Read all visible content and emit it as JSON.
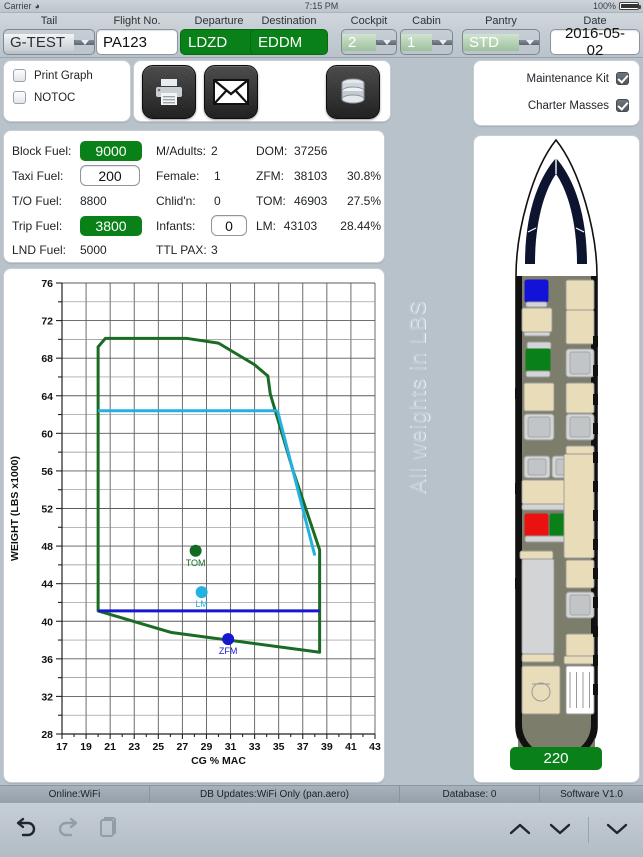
{
  "status_bar": {
    "carrier": "Carrier",
    "wifi_icon": "wifi-icon",
    "time": "7:15 PM",
    "battery_pct": "100%",
    "battery_icon": "battery-icon"
  },
  "form_bar": {
    "fields": [
      {
        "label": "Tail",
        "value": "G-TEST",
        "type": "dropdown-gray"
      },
      {
        "label": "Flight No.",
        "value": "PA123",
        "type": "text"
      },
      {
        "label": "Departure",
        "value": "LDZD",
        "type": "green"
      },
      {
        "label": "Destination",
        "value": "EDDM",
        "type": "green"
      },
      {
        "label": "Cockpit",
        "value": "2",
        "type": "dropdown-green"
      },
      {
        "label": "Cabin",
        "value": "1",
        "type": "dropdown-green"
      },
      {
        "label": "Pantry",
        "value": "STD",
        "type": "dropdown-green"
      },
      {
        "label": "Date",
        "value": "2016-05-02",
        "type": "text"
      }
    ]
  },
  "options_panel": {
    "print_graph": {
      "label": "Print Graph",
      "checked": false
    },
    "notoc": {
      "label": "NOTOC",
      "checked": false
    }
  },
  "action_buttons": [
    {
      "name": "print-button",
      "icon": "printer-icon"
    },
    {
      "name": "email-button",
      "icon": "envelope-icon"
    },
    {
      "name": "database-button",
      "icon": "database-icon"
    }
  ],
  "right_options": {
    "maintenance_kit": {
      "label": "Maintenance Kit",
      "checked": true
    },
    "charter_masses": {
      "label": "Charter Masses",
      "checked": true
    }
  },
  "weights_panel": {
    "fuel": [
      {
        "label": "Block Fuel:",
        "value": "9000",
        "style": "green"
      },
      {
        "label": "Taxi Fuel:",
        "value": "200",
        "style": "input"
      },
      {
        "label": "T/O Fuel:",
        "value": "8800",
        "style": "plain"
      },
      {
        "label": "Trip Fuel:",
        "value": "3800",
        "style": "green"
      },
      {
        "label": "LND Fuel:",
        "value": "5000",
        "style": "plain"
      }
    ],
    "pax": [
      {
        "label": "M/Adults:",
        "value": "2",
        "style": "plain"
      },
      {
        "label": "Female:",
        "value": "1",
        "style": "plain"
      },
      {
        "label": "Chlid'n:",
        "value": "0",
        "style": "plain"
      },
      {
        "label": "Infants:",
        "value": "0",
        "style": "input"
      },
      {
        "label": "TTL PAX:",
        "value": "3",
        "style": "plain"
      }
    ],
    "masses": [
      {
        "label": "DOM:",
        "value": "37256",
        "pct": ""
      },
      {
        "label": "ZFM:",
        "value": "38103",
        "pct": "30.8%"
      },
      {
        "label": "TOM:",
        "value": "46903",
        "pct": "27.5%"
      },
      {
        "label": "LM:",
        "value": "43103",
        "pct": "28.44%"
      }
    ]
  },
  "watermark": "All weights in LBS",
  "aircraft_panel": {
    "cabin_weight_value": "220",
    "seat_markers": [
      {
        "name": "seat-marker-blue",
        "color": "#1313d8"
      },
      {
        "name": "seat-marker-green",
        "color": "#0a8018"
      },
      {
        "name": "seat-marker-red",
        "color": "#ec1111"
      },
      {
        "name": "seat-marker-green2",
        "color": "#0a8018"
      }
    ]
  },
  "bottom_status": [
    {
      "name": "online-status",
      "text": "Online:WiFi"
    },
    {
      "name": "db-updates",
      "text": "DB Updates:WiFi Only   (pan.aero)"
    },
    {
      "name": "database-count",
      "text": "Database: 0"
    },
    {
      "name": "software-version",
      "text": "Software V1.0"
    }
  ],
  "bottom_bar": {
    "undo_icon": "undo-icon",
    "redo_icon": "redo-icon",
    "copy_icon": "copy-icon",
    "up_icon": "chevron-up-icon",
    "down_icon": "chevron-down-icon",
    "dismiss_icon": "chevron-down-dismiss-icon"
  },
  "chart_data": {
    "type": "scatter",
    "title": "",
    "xlabel": "CG % MAC",
    "ylabel": "WEIGHT (LBS x1000)",
    "xlim": [
      17,
      43
    ],
    "ylim": [
      28,
      76
    ],
    "xticks": [
      17,
      19,
      21,
      23,
      25,
      27,
      29,
      31,
      33,
      35,
      37,
      39,
      41,
      43
    ],
    "yticks": [
      28,
      32,
      36,
      40,
      44,
      48,
      52,
      56,
      60,
      64,
      68,
      72,
      76
    ],
    "x_minor_step": 1,
    "y_minor_step": 2,
    "grid": true,
    "legend": "none",
    "series": [
      {
        "name": "envelope",
        "type": "polygon",
        "color": "#1a6b24",
        "points": [
          [
            20.0,
            69.2
          ],
          [
            20.6,
            70.1
          ],
          [
            27.4,
            70.1
          ],
          [
            30.0,
            69.6
          ],
          [
            33.0,
            67.3
          ],
          [
            34.1,
            66.1
          ],
          [
            34.3,
            64.2
          ],
          [
            36.2,
            56.0
          ],
          [
            38.4,
            47.6
          ],
          [
            38.4,
            36.7
          ],
          [
            26.1,
            38.8
          ],
          [
            20.0,
            41.1
          ],
          [
            20.0,
            69.2
          ]
        ]
      },
      {
        "name": "lm-limit-line",
        "type": "hline",
        "color": "#22b1e0",
        "y": 62.4,
        "x_from": 20.0,
        "x_to": 34.9
      },
      {
        "name": "zfm-limit-line",
        "type": "hline",
        "color": "#1717cf",
        "y": 41.1,
        "x_from": 20.0,
        "x_to": 38.4
      },
      {
        "name": "lm-envelope-edge",
        "type": "line",
        "color": "#22b1e0",
        "points": [
          [
            34.9,
            62.4
          ],
          [
            38.0,
            47.0
          ]
        ]
      }
    ],
    "points": [
      {
        "label": "TOM",
        "x": 28.1,
        "y": 47.5,
        "color": "#116b22"
      },
      {
        "label": "LM",
        "x": 28.6,
        "y": 43.1,
        "color": "#22b1e0"
      },
      {
        "label": "ZFM",
        "x": 30.8,
        "y": 38.1,
        "color": "#1717cf"
      }
    ]
  }
}
